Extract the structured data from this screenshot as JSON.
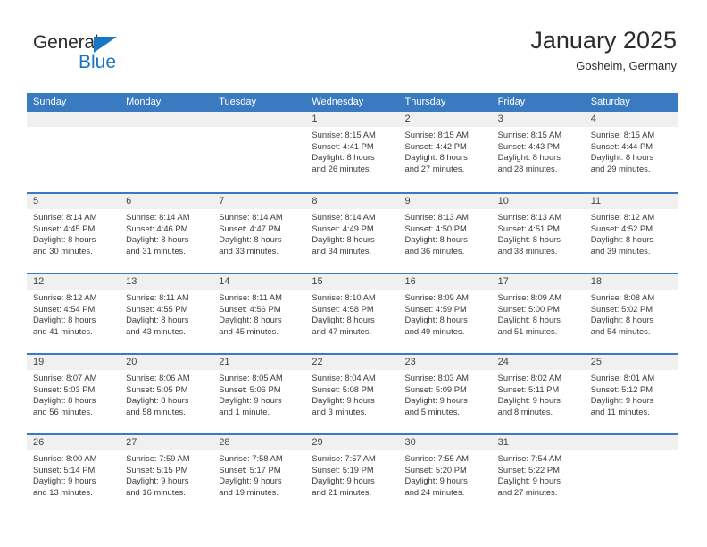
{
  "brand": {
    "name_part1": "General",
    "name_part2": "Blue"
  },
  "header": {
    "month_title": "January 2025",
    "location": "Gosheim, Germany"
  },
  "colors": {
    "header_blue": "#3a7ac0",
    "logo_blue": "#1876c8",
    "date_band": "#f0f0f0",
    "text": "#3a3a3a"
  },
  "weekdays": [
    "Sunday",
    "Monday",
    "Tuesday",
    "Wednesday",
    "Thursday",
    "Friday",
    "Saturday"
  ],
  "weeks": [
    [
      {
        "day": "",
        "empty": true
      },
      {
        "day": "",
        "empty": true
      },
      {
        "day": "",
        "empty": true
      },
      {
        "day": "1",
        "sunrise": "Sunrise: 8:15 AM",
        "sunset": "Sunset: 4:41 PM",
        "daylight1": "Daylight: 8 hours",
        "daylight2": "and 26 minutes."
      },
      {
        "day": "2",
        "sunrise": "Sunrise: 8:15 AM",
        "sunset": "Sunset: 4:42 PM",
        "daylight1": "Daylight: 8 hours",
        "daylight2": "and 27 minutes."
      },
      {
        "day": "3",
        "sunrise": "Sunrise: 8:15 AM",
        "sunset": "Sunset: 4:43 PM",
        "daylight1": "Daylight: 8 hours",
        "daylight2": "and 28 minutes."
      },
      {
        "day": "4",
        "sunrise": "Sunrise: 8:15 AM",
        "sunset": "Sunset: 4:44 PM",
        "daylight1": "Daylight: 8 hours",
        "daylight2": "and 29 minutes."
      }
    ],
    [
      {
        "day": "5",
        "sunrise": "Sunrise: 8:14 AM",
        "sunset": "Sunset: 4:45 PM",
        "daylight1": "Daylight: 8 hours",
        "daylight2": "and 30 minutes."
      },
      {
        "day": "6",
        "sunrise": "Sunrise: 8:14 AM",
        "sunset": "Sunset: 4:46 PM",
        "daylight1": "Daylight: 8 hours",
        "daylight2": "and 31 minutes."
      },
      {
        "day": "7",
        "sunrise": "Sunrise: 8:14 AM",
        "sunset": "Sunset: 4:47 PM",
        "daylight1": "Daylight: 8 hours",
        "daylight2": "and 33 minutes."
      },
      {
        "day": "8",
        "sunrise": "Sunrise: 8:14 AM",
        "sunset": "Sunset: 4:49 PM",
        "daylight1": "Daylight: 8 hours",
        "daylight2": "and 34 minutes."
      },
      {
        "day": "9",
        "sunrise": "Sunrise: 8:13 AM",
        "sunset": "Sunset: 4:50 PM",
        "daylight1": "Daylight: 8 hours",
        "daylight2": "and 36 minutes."
      },
      {
        "day": "10",
        "sunrise": "Sunrise: 8:13 AM",
        "sunset": "Sunset: 4:51 PM",
        "daylight1": "Daylight: 8 hours",
        "daylight2": "and 38 minutes."
      },
      {
        "day": "11",
        "sunrise": "Sunrise: 8:12 AM",
        "sunset": "Sunset: 4:52 PM",
        "daylight1": "Daylight: 8 hours",
        "daylight2": "and 39 minutes."
      }
    ],
    [
      {
        "day": "12",
        "sunrise": "Sunrise: 8:12 AM",
        "sunset": "Sunset: 4:54 PM",
        "daylight1": "Daylight: 8 hours",
        "daylight2": "and 41 minutes."
      },
      {
        "day": "13",
        "sunrise": "Sunrise: 8:11 AM",
        "sunset": "Sunset: 4:55 PM",
        "daylight1": "Daylight: 8 hours",
        "daylight2": "and 43 minutes."
      },
      {
        "day": "14",
        "sunrise": "Sunrise: 8:11 AM",
        "sunset": "Sunset: 4:56 PM",
        "daylight1": "Daylight: 8 hours",
        "daylight2": "and 45 minutes."
      },
      {
        "day": "15",
        "sunrise": "Sunrise: 8:10 AM",
        "sunset": "Sunset: 4:58 PM",
        "daylight1": "Daylight: 8 hours",
        "daylight2": "and 47 minutes."
      },
      {
        "day": "16",
        "sunrise": "Sunrise: 8:09 AM",
        "sunset": "Sunset: 4:59 PM",
        "daylight1": "Daylight: 8 hours",
        "daylight2": "and 49 minutes."
      },
      {
        "day": "17",
        "sunrise": "Sunrise: 8:09 AM",
        "sunset": "Sunset: 5:00 PM",
        "daylight1": "Daylight: 8 hours",
        "daylight2": "and 51 minutes."
      },
      {
        "day": "18",
        "sunrise": "Sunrise: 8:08 AM",
        "sunset": "Sunset: 5:02 PM",
        "daylight1": "Daylight: 8 hours",
        "daylight2": "and 54 minutes."
      }
    ],
    [
      {
        "day": "19",
        "sunrise": "Sunrise: 8:07 AM",
        "sunset": "Sunset: 5:03 PM",
        "daylight1": "Daylight: 8 hours",
        "daylight2": "and 56 minutes."
      },
      {
        "day": "20",
        "sunrise": "Sunrise: 8:06 AM",
        "sunset": "Sunset: 5:05 PM",
        "daylight1": "Daylight: 8 hours",
        "daylight2": "and 58 minutes."
      },
      {
        "day": "21",
        "sunrise": "Sunrise: 8:05 AM",
        "sunset": "Sunset: 5:06 PM",
        "daylight1": "Daylight: 9 hours",
        "daylight2": "and 1 minute."
      },
      {
        "day": "22",
        "sunrise": "Sunrise: 8:04 AM",
        "sunset": "Sunset: 5:08 PM",
        "daylight1": "Daylight: 9 hours",
        "daylight2": "and 3 minutes."
      },
      {
        "day": "23",
        "sunrise": "Sunrise: 8:03 AM",
        "sunset": "Sunset: 5:09 PM",
        "daylight1": "Daylight: 9 hours",
        "daylight2": "and 5 minutes."
      },
      {
        "day": "24",
        "sunrise": "Sunrise: 8:02 AM",
        "sunset": "Sunset: 5:11 PM",
        "daylight1": "Daylight: 9 hours",
        "daylight2": "and 8 minutes."
      },
      {
        "day": "25",
        "sunrise": "Sunrise: 8:01 AM",
        "sunset": "Sunset: 5:12 PM",
        "daylight1": "Daylight: 9 hours",
        "daylight2": "and 11 minutes."
      }
    ],
    [
      {
        "day": "26",
        "sunrise": "Sunrise: 8:00 AM",
        "sunset": "Sunset: 5:14 PM",
        "daylight1": "Daylight: 9 hours",
        "daylight2": "and 13 minutes."
      },
      {
        "day": "27",
        "sunrise": "Sunrise: 7:59 AM",
        "sunset": "Sunset: 5:15 PM",
        "daylight1": "Daylight: 9 hours",
        "daylight2": "and 16 minutes."
      },
      {
        "day": "28",
        "sunrise": "Sunrise: 7:58 AM",
        "sunset": "Sunset: 5:17 PM",
        "daylight1": "Daylight: 9 hours",
        "daylight2": "and 19 minutes."
      },
      {
        "day": "29",
        "sunrise": "Sunrise: 7:57 AM",
        "sunset": "Sunset: 5:19 PM",
        "daylight1": "Daylight: 9 hours",
        "daylight2": "and 21 minutes."
      },
      {
        "day": "30",
        "sunrise": "Sunrise: 7:55 AM",
        "sunset": "Sunset: 5:20 PM",
        "daylight1": "Daylight: 9 hours",
        "daylight2": "and 24 minutes."
      },
      {
        "day": "31",
        "sunrise": "Sunrise: 7:54 AM",
        "sunset": "Sunset: 5:22 PM",
        "daylight1": "Daylight: 9 hours",
        "daylight2": "and 27 minutes."
      },
      {
        "day": "",
        "empty": true
      }
    ]
  ]
}
